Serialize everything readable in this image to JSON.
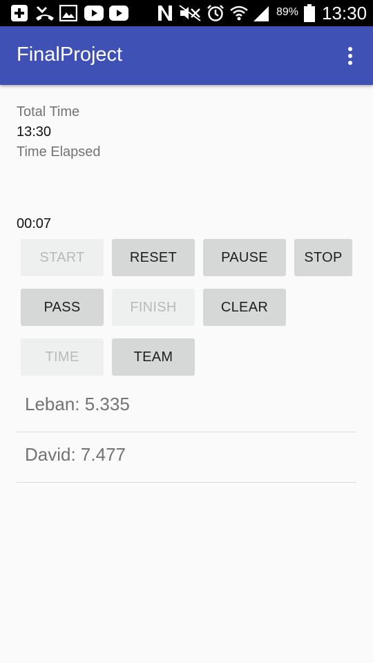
{
  "status_bar": {
    "icons": [
      "add-box-icon",
      "missed-call-icon",
      "image-icon",
      "youtube-icon",
      "youtube-icon",
      "nfc-icon",
      "mute-icon",
      "alarm-icon",
      "wifi-icon",
      "signal-icon",
      "battery-icon"
    ],
    "battery_percent": "89%",
    "time": "13:30"
  },
  "app_bar": {
    "title": "FinalProject",
    "color": "#3f51b5",
    "menu_icon": "more-vert-icon"
  },
  "timer": {
    "total_time_label": "Total Time",
    "total_time_value": "13:30",
    "elapsed_label": "Time Elapsed",
    "elapsed_value": "00:07"
  },
  "buttons": {
    "start": "START",
    "reset": "RESET",
    "pause": "PAUSE",
    "stop": "STOP",
    "pass": "PASS",
    "finish": "FINISH",
    "clear": "CLEAR",
    "time": "TIME",
    "team": "TEAM"
  },
  "results": [
    "Leban: 5.335",
    "David: 7.477"
  ]
}
